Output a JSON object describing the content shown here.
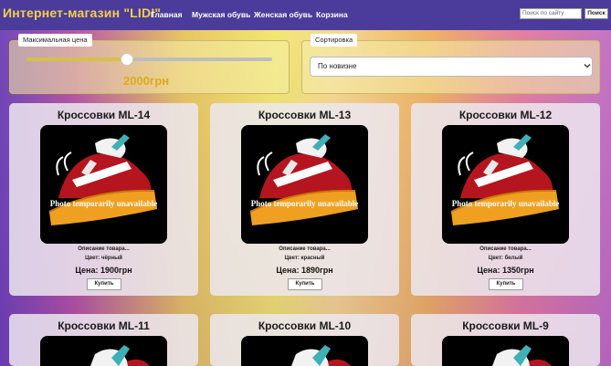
{
  "nav": {
    "brand": "Интернет-магазин \"LIDI\"",
    "links": [
      "Главная",
      "Мужская обувь",
      "Женская обувь",
      "Корзина"
    ],
    "search_placeholder": "Поиск по сайту",
    "search_button": "Поиск"
  },
  "filters": {
    "price_legend": "Максимальная цена",
    "price_value": "2000грн",
    "price_slider_fraction": 0.41,
    "sort_legend": "Сортировка",
    "sort_selected": "По новизне"
  },
  "products": [
    {
      "title": "Кроссовки ML-14",
      "desc": "Описание товара...",
      "color": "Цвет: чёрный",
      "price": "Цена: 1900грн",
      "buy": "Купить",
      "image_text": "Photo temporarily unavailable"
    },
    {
      "title": "Кроссовки ML-13",
      "desc": "Описание товара...",
      "color": "Цвет: красный",
      "price": "Цена: 1890грн",
      "buy": "Купить",
      "image_text": "Photo temporarily unavailable"
    },
    {
      "title": "Кроссовки ML-12",
      "desc": "Описание товара...",
      "color": "Цвет: белый",
      "price": "Цена: 1350грн",
      "buy": "Купить",
      "image_text": "Photo temporarily unavailable"
    },
    {
      "title": "Кроссовки ML-11"
    },
    {
      "title": "Кроссовки ML-10"
    },
    {
      "title": "Кроссовки ML-9"
    }
  ],
  "colors": {
    "navbar": "#4b3b9a",
    "brand": "#f4d04a",
    "price_readout": "#e0a91a"
  }
}
